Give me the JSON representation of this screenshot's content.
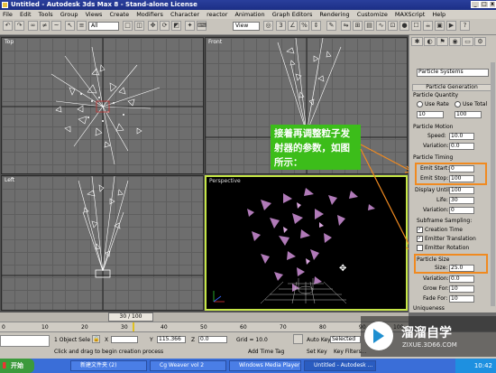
{
  "window": {
    "title": "Untitled - Autodesk 3ds Max 8 - Stand-alone License"
  },
  "menu": [
    "File",
    "Edit",
    "Tools",
    "Group",
    "Views",
    "Create",
    "Modifiers",
    "Character",
    "reactor",
    "Animation",
    "Graph Editors",
    "Rendering",
    "Customize",
    "MAXScript",
    "Help"
  ],
  "toolbar": {
    "filter": "All",
    "view": "View"
  },
  "viewports": {
    "top": "Top",
    "front": "Front",
    "left": "Left",
    "perspective": "Perspective"
  },
  "panel": {
    "combo": "Particle Systems",
    "rollout_generation": "Particle Generation",
    "particle_quantity": "Particle Quantity",
    "use_rate": "Use Rate",
    "use_total": "Use Total",
    "rate_value": "10",
    "total_value": "100",
    "particle_motion": "Particle Motion",
    "speed_label": "Speed:",
    "speed": "10.0",
    "variation_label": "Variation:",
    "variation1": "0.0",
    "particle_timing": "Particle Timing",
    "emit_start_label": "Emit Start:",
    "emit_start": "0",
    "emit_stop_label": "Emit Stop:",
    "emit_stop": "100",
    "display_until_label": "Display Until:",
    "display_until": "100",
    "life_label": "Life:",
    "life": "30",
    "variation2": "0",
    "subframe": "Subframe Sampling:",
    "creation_time": "Creation Time",
    "emitter_translation": "Emitter Translation",
    "emitter_rotation": "Emitter Rotation",
    "particle_size": "Particle Size",
    "size_label": "Size:",
    "size": "25.0",
    "variation3": "0.0",
    "grow_for_label": "Grow For:",
    "grow_for": "10",
    "fade_for_label": "Fade For:",
    "fade_for": "10",
    "uniqueness": "Uniqueness"
  },
  "callout": {
    "text": "接着再调整粒子发射器的参数，如图所示："
  },
  "timeline": {
    "frame": "30 / 100",
    "ticks": [
      "0",
      "10",
      "20",
      "30",
      "40",
      "50",
      "60",
      "70",
      "80",
      "90",
      "100"
    ]
  },
  "status": {
    "selection": "1 Object Sele",
    "prompt": "Click and drag to begin creation process",
    "x_label": "X",
    "x": "",
    "y_label": "Y",
    "y": "115.366",
    "z_label": "Z",
    "z": "0.0",
    "grid": "Grid = 10.0",
    "add_time_tag": "Add Time Tag",
    "auto_key": "Auto Key",
    "set_key": "Set Key",
    "selected": "Selected",
    "key_filters": "Key Filters..."
  },
  "taskbar": {
    "start": "开始",
    "items": [
      "新建文件夹 (2)",
      "Cg Weaver vol 2",
      "Windows Media Player",
      "Untitled - Autodesk ..."
    ],
    "clock": "10:42"
  },
  "watermark": {
    "title": "溜溜自学",
    "url": "ZIXUE.3D66.COM"
  },
  "colors": {
    "accent": "#c6e646",
    "callout": "#3cbd1a",
    "highlight": "#f08a20"
  }
}
